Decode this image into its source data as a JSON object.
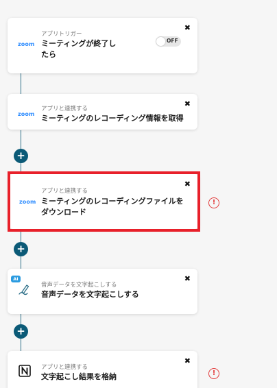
{
  "colors": {
    "accent": "#0b5a77",
    "zoom_brand": "#2d8cff",
    "highlight": "#e8202a",
    "warning": "#e23b3b",
    "ai_badge": "#2b9be0"
  },
  "steps": [
    {
      "logo": "zoom",
      "caption": "アプリトリガー",
      "title_line1": "ミーティングが終了し",
      "title_line2": "たら",
      "toggle_label": "OFF",
      "close_glyph": "✖"
    },
    {
      "logo": "zoom",
      "caption": "アプリと連携する",
      "title_line1": "ミーティングのレコーディング情報を取得",
      "close_glyph": "✖"
    },
    {
      "logo": "zoom",
      "caption": "アプリと連携する",
      "title_line1": "ミーティングのレコーディングファイルを",
      "title_line2": "ダウンロード",
      "close_glyph": "✖",
      "warning_glyph": "!"
    },
    {
      "badge": "AI",
      "icon": "pen-icon",
      "caption": "音声データを文字起こしする",
      "title_line1": "音声データを文字起こしする",
      "close_glyph": "✖"
    },
    {
      "icon": "notion-icon",
      "caption": "アプリと連携する",
      "title_line1": "文字起こし結果を格納",
      "close_glyph": "✖",
      "warning_glyph": "!"
    }
  ],
  "add_button_label": "+"
}
